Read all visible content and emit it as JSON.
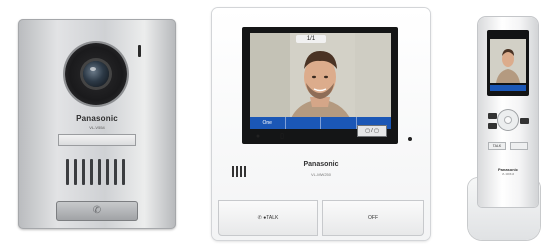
{
  "door_station": {
    "brand": "Panasonic",
    "model": "VL-V554",
    "icons": {
      "camera": "camera-lens-icon",
      "call": "doorbell-icon"
    }
  },
  "monitor": {
    "brand": "Panasonic",
    "model": "VL-MW250",
    "status": "1/1",
    "soft_keys": [
      "One",
      "",
      "",
      ""
    ],
    "mode_button": "▢ / ▢",
    "talk_label": "✆ ●TALK",
    "off_label": "OFF"
  },
  "handset": {
    "brand": "Panasonic",
    "model": "VL-WD613",
    "talk_label": "TALK"
  },
  "colors": {
    "softbar": "#1b57b6",
    "panel_silver": "#d0d2d5",
    "monitor_white": "#f7f8f8"
  }
}
